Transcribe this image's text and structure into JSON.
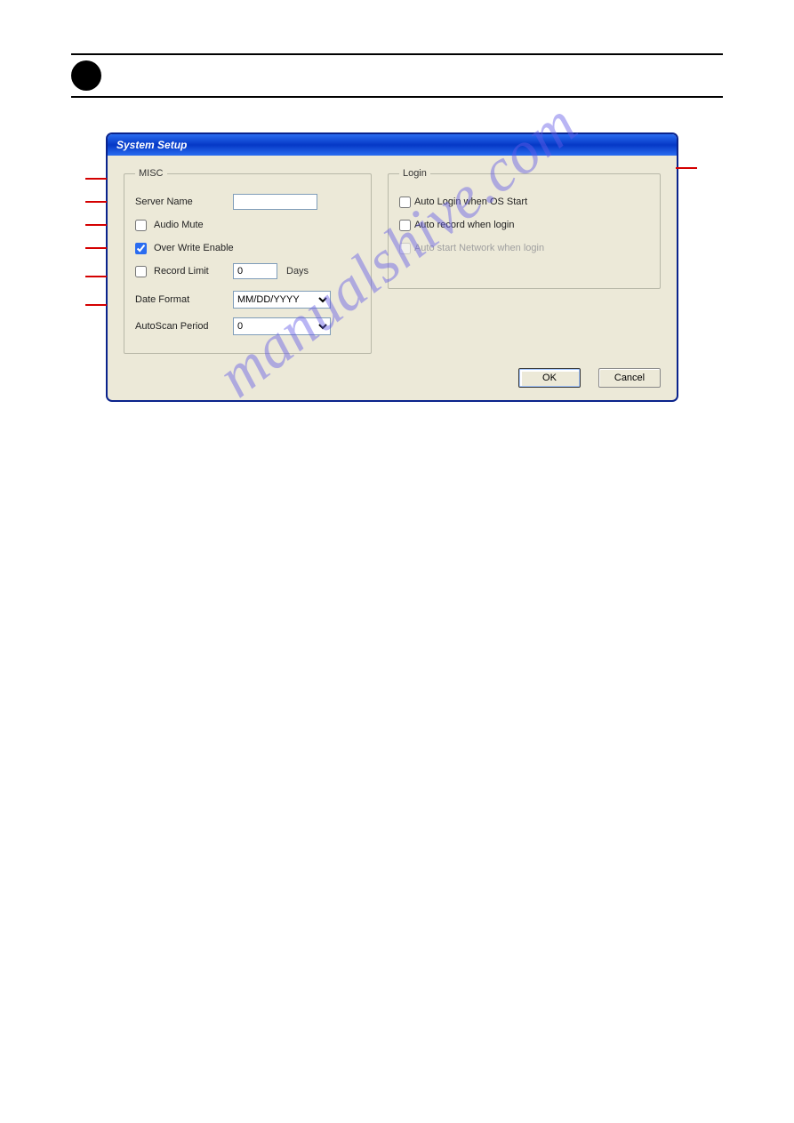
{
  "dialog": {
    "title": "System Setup",
    "misc": {
      "legend": "MISC",
      "serverNameLabel": "Server Name",
      "serverNameValue": "",
      "audioMuteLabel": "Audio Mute",
      "audioMuteChecked": false,
      "overWriteLabel": "Over Write Enable",
      "overWriteChecked": true,
      "recordLimitLabel": "Record Limit",
      "recordLimitChecked": false,
      "recordLimitValue": "0",
      "daysLabel": "Days",
      "dateFormatLabel": "Date Format",
      "dateFormatValue": "MM/DD/YYYY",
      "autoScanLabel": "AutoScan Period",
      "autoScanValue": "0"
    },
    "login": {
      "legend": "Login",
      "autoLoginLabel": "Auto Login when OS Start",
      "autoLoginChecked": false,
      "autoRecordLabel": "Auto record when login",
      "autoRecordChecked": false,
      "autoNetworkLabel": "Auto start Network when login",
      "autoNetworkChecked": false,
      "autoNetworkDisabled": true
    },
    "okLabel": "OK",
    "cancelLabel": "Cancel"
  },
  "watermark": "manualshive.com"
}
